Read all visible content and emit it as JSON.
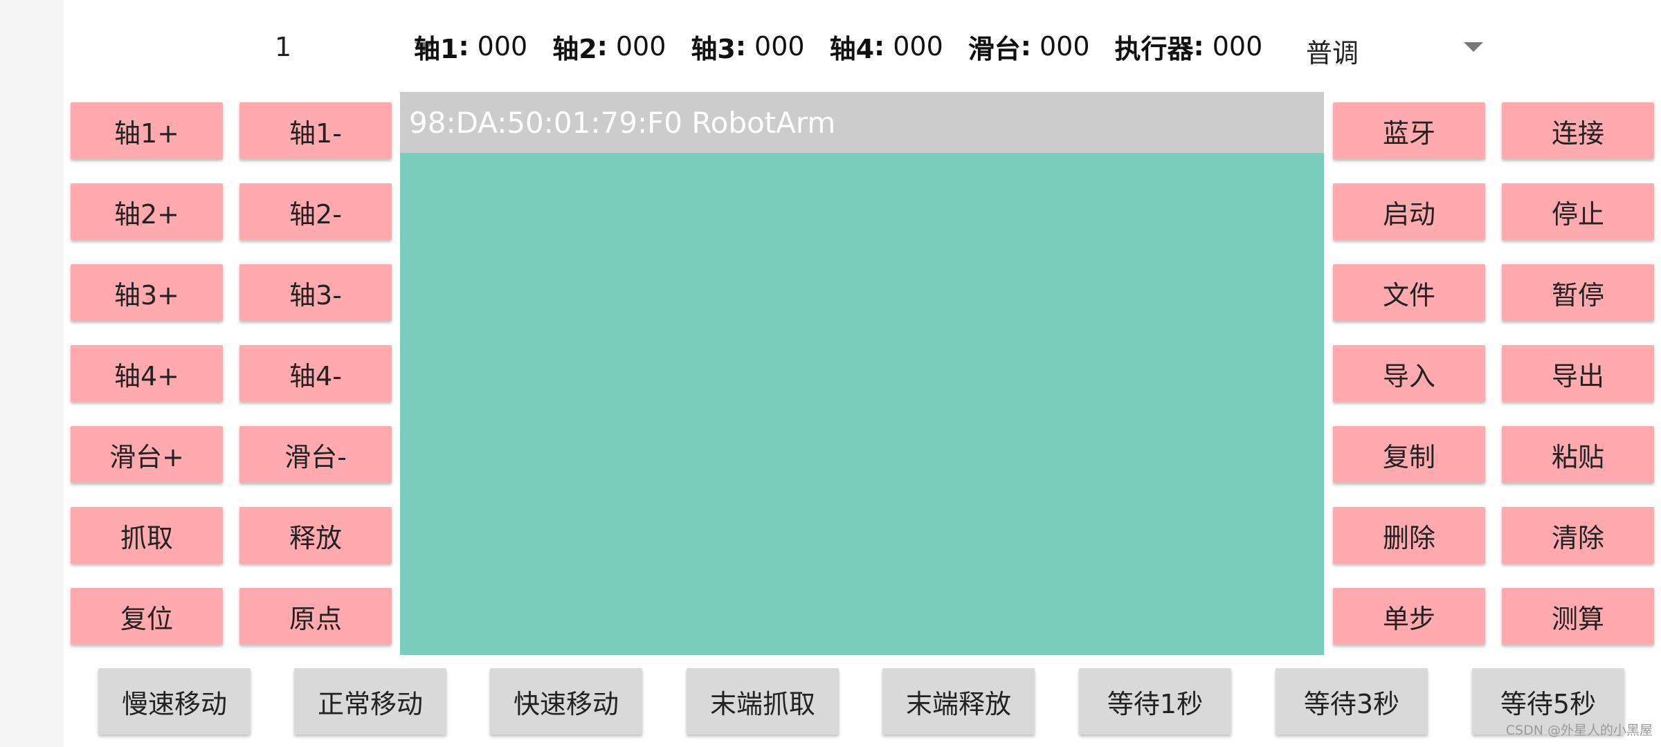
{
  "top": {
    "number_spinner_value": "1",
    "readouts": [
      {
        "label": "轴1",
        "value": "000"
      },
      {
        "label": "轴2",
        "value": "000"
      },
      {
        "label": "轴3",
        "value": "000"
      },
      {
        "label": "轴4",
        "value": "000"
      },
      {
        "label": "滑台",
        "value": "000"
      },
      {
        "label": "执行器",
        "value": "000"
      }
    ],
    "separator": ":",
    "mode_spinner_value": "普调"
  },
  "left_buttons": [
    [
      "轴1+",
      "轴1-"
    ],
    [
      "轴2+",
      "轴2-"
    ],
    [
      "轴3+",
      "轴3-"
    ],
    [
      "轴4+",
      "轴4-"
    ],
    [
      "滑台+",
      "滑台-"
    ],
    [
      "抓取",
      "释放"
    ],
    [
      "复位",
      "原点"
    ]
  ],
  "right_buttons": [
    [
      "蓝牙",
      "连接"
    ],
    [
      "启动",
      "停止"
    ],
    [
      "文件",
      "暂停"
    ],
    [
      "导入",
      "导出"
    ],
    [
      "复制",
      "粘贴"
    ],
    [
      "删除",
      "清除"
    ],
    [
      "单步",
      "测算"
    ]
  ],
  "device_list": {
    "items": [
      "98:DA:50:01:79:F0 RobotArm"
    ]
  },
  "bottom_buttons": [
    "慢速移动",
    "正常移动",
    "快速移动",
    "末端抓取",
    "末端释放",
    "等待1秒",
    "等待3秒",
    "等待5秒"
  ],
  "watermark": "CSDN @外星人的小黑屋",
  "colors": {
    "button_pink": "#ffaaaf",
    "button_gray": "#d9d9d9",
    "panel_teal": "#7accbd",
    "list_item_gray": "#cccccc"
  }
}
